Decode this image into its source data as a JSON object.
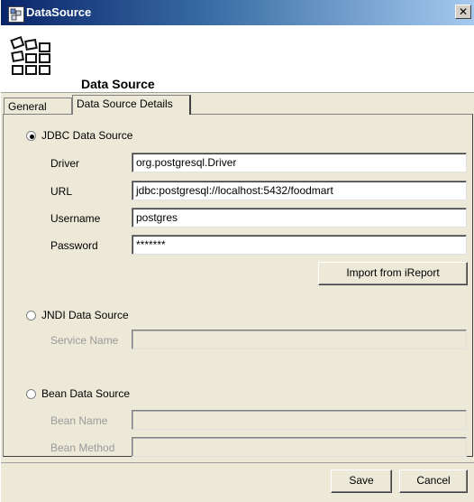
{
  "window": {
    "title": "DataSource",
    "close_glyph": "✕",
    "icon": "datasource-app-icon"
  },
  "header": {
    "title": "Data Source",
    "icon": "datasource-grid-icon"
  },
  "tabs": [
    {
      "label": "General",
      "selected": false
    },
    {
      "label": "Data Source Details",
      "selected": true
    }
  ],
  "jdbc": {
    "label": "JDBC Data Source",
    "selected": true,
    "driver_label": "Driver",
    "driver_value": "org.postgresql.Driver",
    "url_label": "URL",
    "url_value": "jdbc:postgresql://localhost:5432/foodmart",
    "username_label": "Username",
    "username_value": "postgres",
    "password_label": "Password",
    "password_value": "*******",
    "import_button": "Import from iReport"
  },
  "jndi": {
    "label": "JNDI Data Source",
    "selected": false,
    "service_name_label": "Service Name",
    "service_name_value": ""
  },
  "bean": {
    "label": "Bean Data Source",
    "selected": false,
    "bean_name_label": "Bean Name",
    "bean_name_value": "",
    "bean_method_label": "Bean Method",
    "bean_method_value": ""
  },
  "footer": {
    "save": "Save",
    "cancel": "Cancel"
  }
}
